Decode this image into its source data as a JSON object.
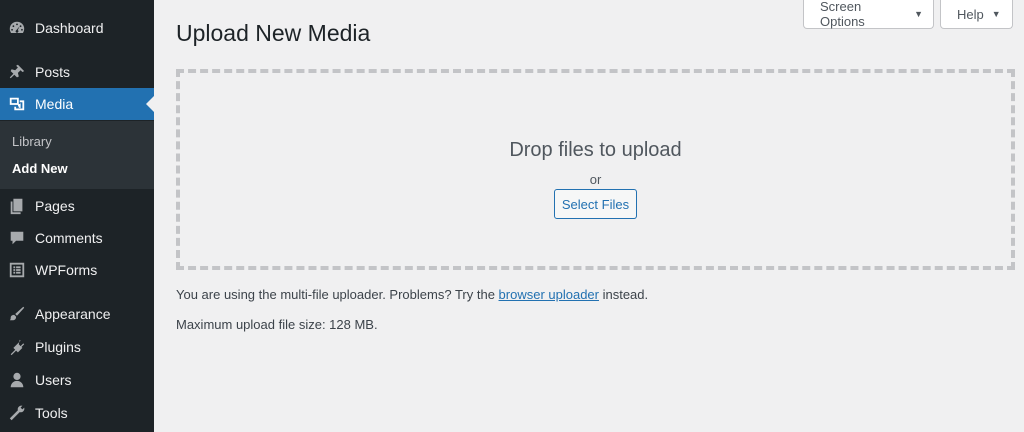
{
  "sidebar": {
    "dashboard": "Dashboard",
    "posts": "Posts",
    "media": "Media",
    "submenu": {
      "library": "Library",
      "add_new": "Add New"
    },
    "pages": "Pages",
    "comments": "Comments",
    "wpforms": "WPForms",
    "appearance": "Appearance",
    "plugins": "Plugins",
    "users": "Users",
    "tools": "Tools"
  },
  "header": {
    "screen_options": "Screen Options",
    "help": "Help",
    "dropdown_arrow": "▼"
  },
  "main": {
    "title": "Upload New Media",
    "drop_text": "Drop files to upload",
    "or_text": "or",
    "select_files": "Select Files",
    "uploader_text_before": "You are using the multi-file uploader. Problems? Try the ",
    "uploader_link": "browser uploader",
    "uploader_text_after": " instead.",
    "max_size": "Maximum upload file size: 128 MB."
  },
  "colors": {
    "sidebar_bg": "#1d2327",
    "accent": "#2271b1",
    "page_bg": "#f0f0f1"
  }
}
